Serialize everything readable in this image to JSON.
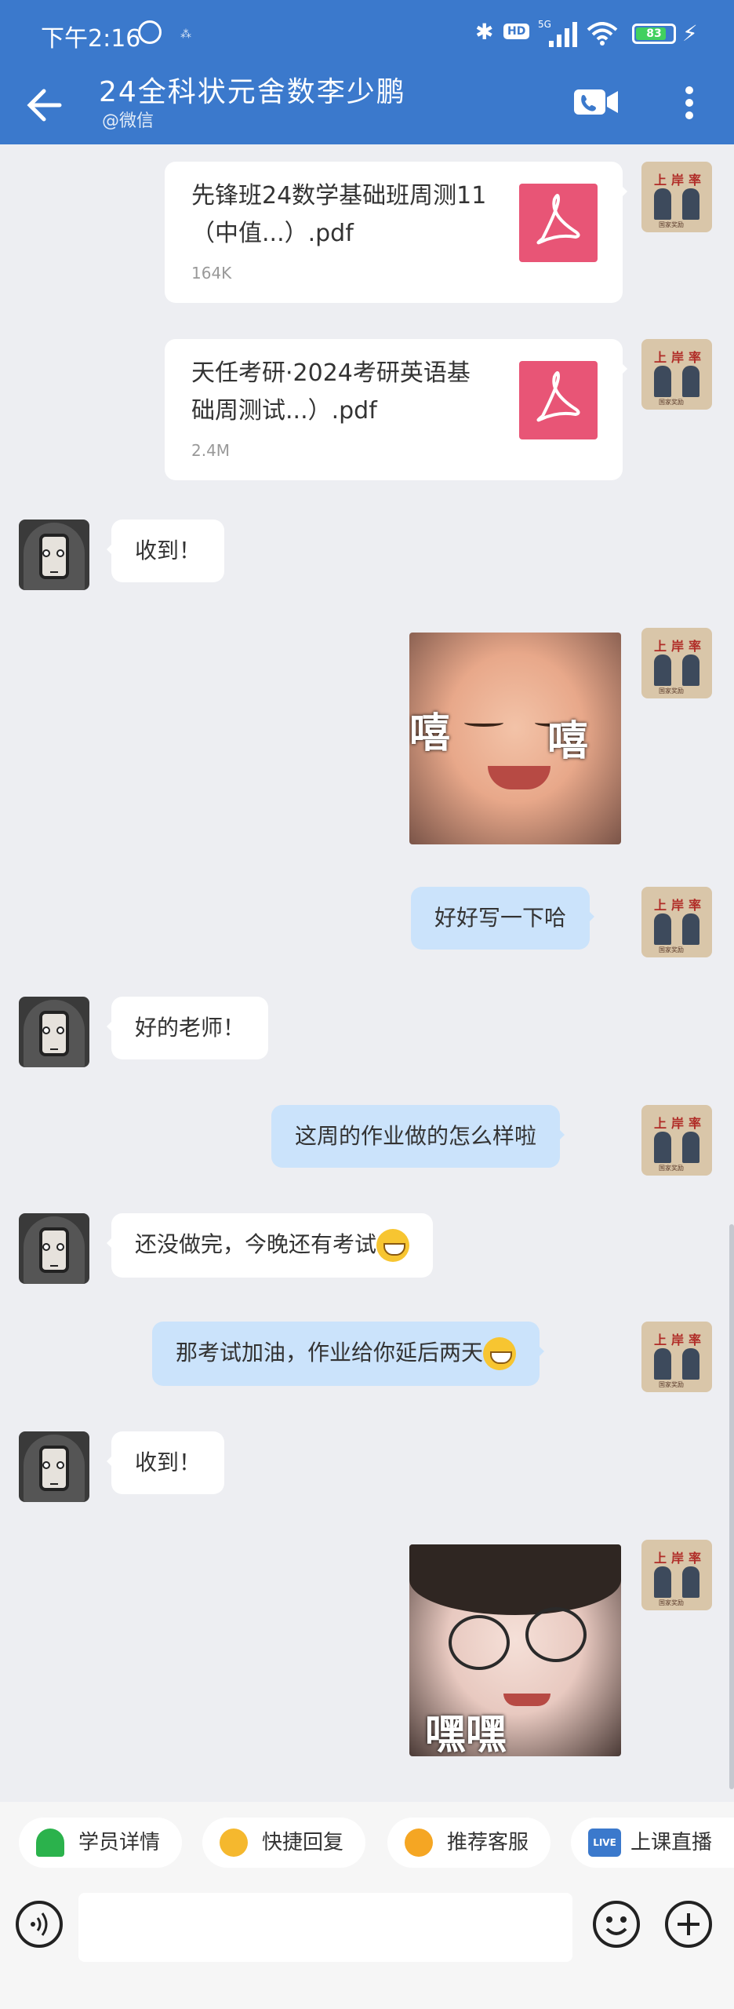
{
  "status": {
    "time": "下午2:16",
    "mark": "⁂",
    "hd": "HD",
    "generation": "5G",
    "battery": "83"
  },
  "header": {
    "title": "24全科状元舍数李少鹏",
    "subtitle": "@微信"
  },
  "colors": {
    "header": "#3b79cc",
    "chat_bg": "#edeef2",
    "bubble_blue": "#cbe3fb",
    "pdf": "#e85576"
  },
  "teacher_avatar": {
    "title": "上岸率采",
    "caption": "国家奖励"
  },
  "messages": [
    {
      "type": "file",
      "side": "right",
      "name": "先锋班24数学基础班周测11（中值...）.pdf",
      "size": "164K"
    },
    {
      "type": "file",
      "side": "right",
      "name": "天任考研·2024考研英语基础周测试...）.pdf",
      "size": "2.4M"
    },
    {
      "type": "text",
      "side": "left",
      "text": "收到！"
    },
    {
      "type": "sticker",
      "side": "right",
      "caption_left": "嘻",
      "caption_right": "嘻"
    },
    {
      "type": "text",
      "side": "right",
      "text": "好好写一下哈"
    },
    {
      "type": "text",
      "side": "left",
      "text": "好的老师！"
    },
    {
      "type": "text",
      "side": "right",
      "text": "这周的作业做的怎么样啦"
    },
    {
      "type": "text",
      "side": "left",
      "text": "还没做完，今晚还有考试",
      "emoji": "crying-laughing-icon"
    },
    {
      "type": "text",
      "side": "right",
      "text": "那考试加油，作业给你延后两天",
      "emoji": "grinning-face-icon"
    },
    {
      "type": "text",
      "side": "left",
      "text": "收到！"
    },
    {
      "type": "sticker",
      "side": "right",
      "caption": "嘿嘿"
    }
  ],
  "quick_actions": [
    {
      "label": "学员详情",
      "icon": "user-detail-icon",
      "color": "#2bb24c"
    },
    {
      "label": "快捷回复",
      "icon": "quick-reply-icon",
      "color": "#f5b82e"
    },
    {
      "label": "推荐客服",
      "icon": "service-icon",
      "color": "#f5a623"
    },
    {
      "label": "上课直播",
      "icon": "live-icon",
      "badge": "LIVE",
      "color": "#3b79cc"
    }
  ]
}
